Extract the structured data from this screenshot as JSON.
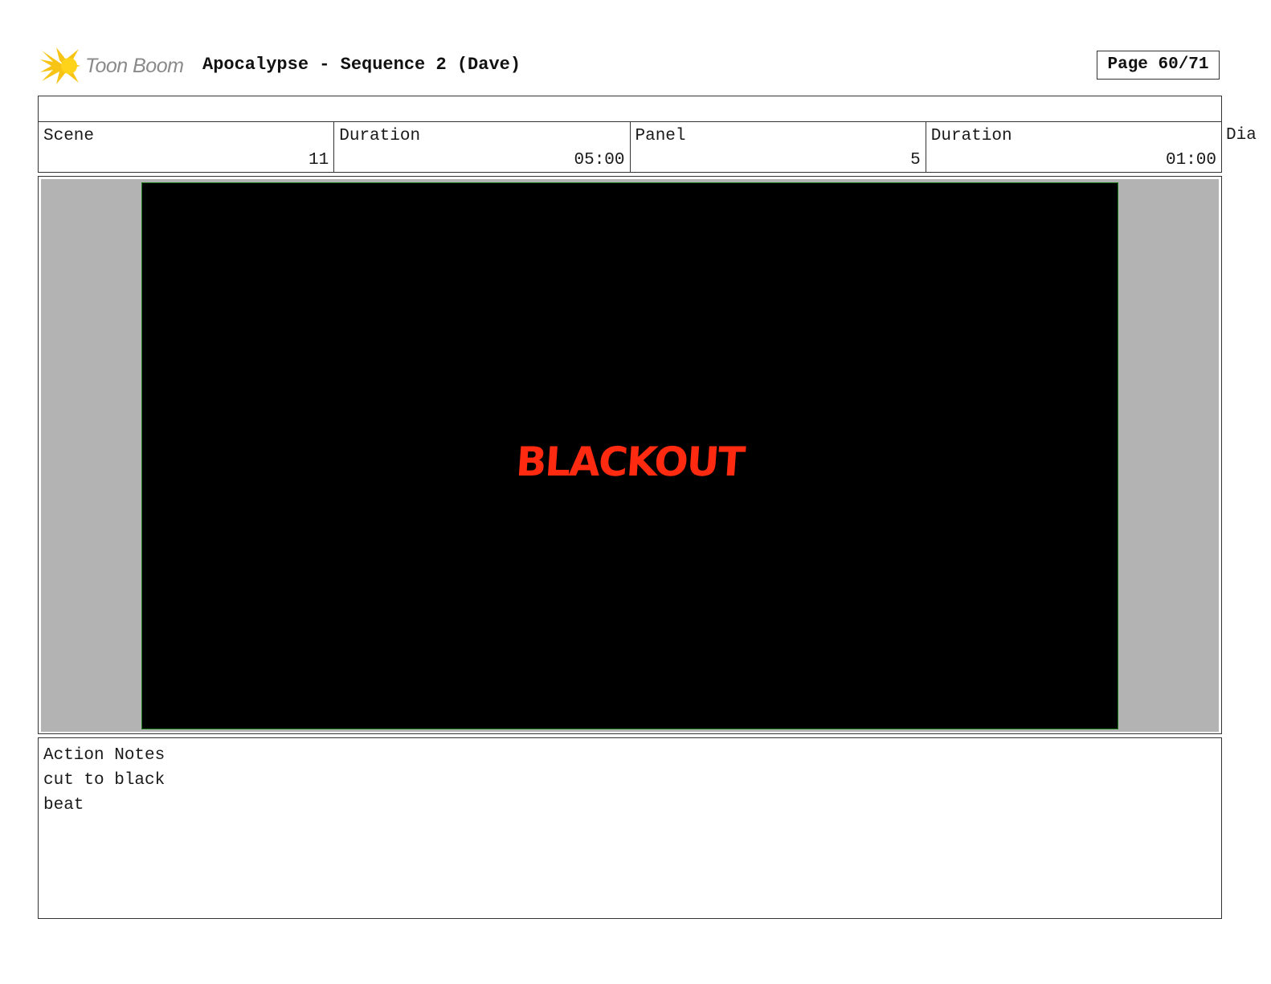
{
  "header": {
    "logo_text": "Toon Boom",
    "title": "Apocalypse - Sequence 2 (Dave)",
    "page_label": "Page 60/71"
  },
  "info": {
    "scene_label": "Scene",
    "scene_value": "11",
    "scene_duration_label": "Duration",
    "scene_duration_value": "05:00",
    "panel_label": "Panel",
    "panel_value": "5",
    "panel_duration_label": "Duration",
    "panel_duration_value": "01:00",
    "overflow_label": "Dia"
  },
  "panel": {
    "caption": "BLACKOUT",
    "caption_color": "#ff2a10"
  },
  "notes": {
    "title": "Action Notes",
    "line1": "cut to black",
    "line2": "beat"
  },
  "icons": [
    "toon-boom-logo-icon"
  ]
}
